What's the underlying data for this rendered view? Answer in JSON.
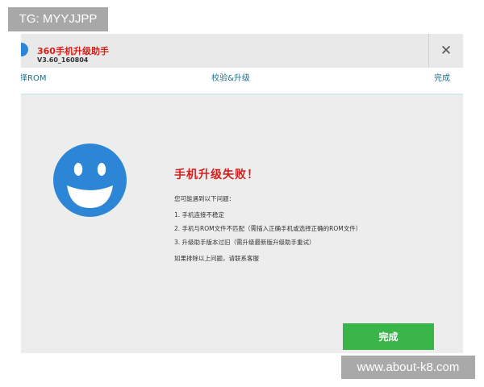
{
  "watermarks": {
    "top": "TG: MYYJJPP",
    "bottom": "www.about-k8.com"
  },
  "app": {
    "name": "360手机升级助手",
    "version": "V3.60_160804"
  },
  "window": {
    "close_glyph": "✕"
  },
  "steps": [
    "择ROM",
    "校验&升级",
    "完成"
  ],
  "result": {
    "title": "手机升级失败！",
    "intro": "您可能遇到以下问题：",
    "reasons": [
      "1. 手机连接不稳定",
      "2. 手机与ROM文件不匹配（需插入正确手机或选择正确的ROM文件）",
      "3. 升级助手版本过旧（需升级最新版升级助手重试）"
    ],
    "outro": "如果排除以上问题，请联系客服"
  },
  "buttons": {
    "done": "完成"
  },
  "icons": {
    "app_logo": "app-logo-icon",
    "close": "close-icon",
    "status": "smiley-face-icon"
  },
  "colors": {
    "brand_red": "#d21f1f",
    "step_text": "#1f6f8b",
    "smiley": "#2d85d6",
    "done_button": "#39b54a"
  }
}
